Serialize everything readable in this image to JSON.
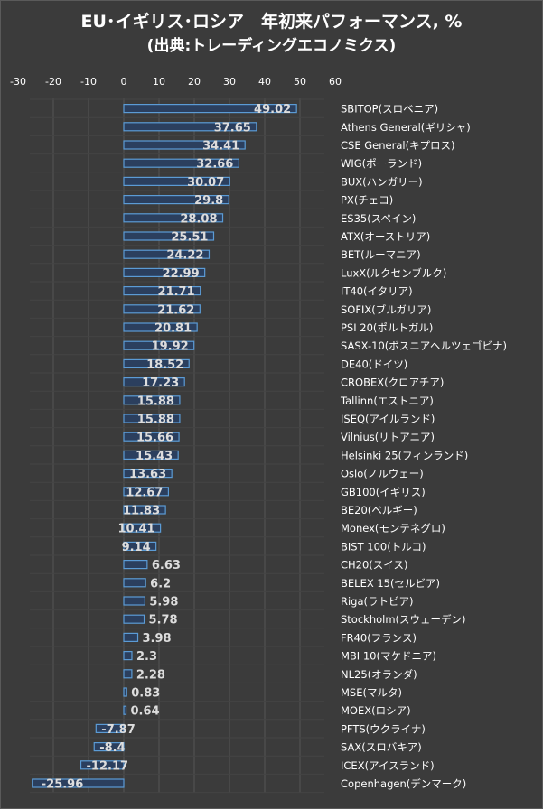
{
  "title": "EU･イギリス･ロシア　年初来パフォーマンス, %",
  "subtitle": "(出典:トレーディングエコノミクス)",
  "colors": {
    "background": "#3b3b3b",
    "bar_fill": "#2b3f5e",
    "bar_stroke": "#5b9bd5",
    "grid": "#555555",
    "text": "#ffffff",
    "value_text": "#dddddd"
  },
  "chart_data": {
    "type": "bar",
    "orientation": "horizontal",
    "xlim": [
      -30,
      60
    ],
    "x_ticks": [
      "-30",
      "-20",
      "-10",
      "0",
      "10",
      "20",
      "30",
      "40",
      "50",
      "60"
    ],
    "grid": true,
    "categories": [
      "SBITOP(スロベニア)",
      "Athens General(ギリシャ)",
      "CSE General(キプロス)",
      "WIG(ポーランド)",
      "BUX(ハンガリー)",
      "PX(チェコ)",
      "ES35(スペイン)",
      "ATX(オーストリア)",
      "BET(ルーマニア)",
      "LuxX(ルクセンブルク)",
      "IT40(イタリア)",
      "SOFIX(ブルガリア)",
      "PSI 20(ポルトガル)",
      "SASX-10(ボスニアヘルツェゴビナ)",
      "DE40(ドイツ)",
      "CROBEX(クロアチア)",
      "Tallinn(エストニア)",
      "ISEQ(アイルランド)",
      "Vilnius(リトアニア)",
      "Helsinki 25(フィンランド)",
      "Oslo(ノルウェー)",
      "GB100(イギリス)",
      "BE20(ベルギー)",
      "Monex(モンテネグロ)",
      "BIST 100(トルコ)",
      "CH20(スイス)",
      "BELEX 15(セルビア)",
      "Riga(ラトビア)",
      "Stockholm(スウェーデン)",
      "FR40(フランス)",
      "MBI 10(マケドニア)",
      "NL25(オランダ)",
      "MSE(マルタ)",
      "MOEX(ロシア)",
      "PFTS(ウクライナ)",
      "SAX(スロバキア)",
      "ICEX(アイスランド)",
      "Copenhagen(デンマーク)"
    ],
    "values": [
      49.02,
      37.65,
      34.41,
      32.66,
      30.07,
      29.8,
      28.08,
      25.51,
      24.22,
      22.99,
      21.71,
      21.62,
      20.81,
      19.92,
      18.52,
      17.23,
      15.88,
      15.88,
      15.66,
      15.43,
      13.63,
      12.67,
      11.83,
      10.41,
      9.14,
      6.63,
      6.2,
      5.98,
      5.78,
      3.98,
      2.3,
      2.28,
      0.83,
      0.64,
      -7.87,
      -8.4,
      -12.17,
      -25.96
    ],
    "value_labels": [
      "49.02",
      "37.65",
      "34.41",
      "32.66",
      "30.07",
      "29.8",
      "28.08",
      "25.51",
      "24.22",
      "22.99",
      "21.71",
      "21.62",
      "20.81",
      "19.92",
      "18.52",
      "17.23",
      "15.88",
      "15.88",
      "15.66",
      "15.43",
      "13.63",
      "12.67",
      "11.83",
      "10.41",
      "9.14",
      "6.63",
      "6.2",
      "5.98",
      "5.78",
      "3.98",
      "2.3",
      "2.28",
      "0.83",
      "0.64",
      "-7.87",
      "-8.4",
      "-12.17",
      "-25.96"
    ]
  }
}
